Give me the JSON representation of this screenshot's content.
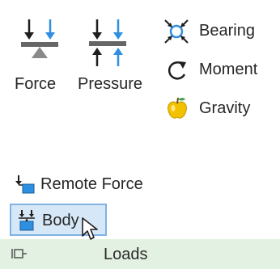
{
  "ribbon_panel": {
    "title": "Loads",
    "buttons": {
      "force": {
        "label": "Force",
        "icon": "force-icon"
      },
      "pressure": {
        "label": "Pressure",
        "icon": "pressure-icon"
      },
      "bearing": {
        "label": "Bearing",
        "icon": "bearing-icon"
      },
      "moment": {
        "label": "Moment",
        "icon": "moment-icon"
      },
      "gravity": {
        "label": "Gravity",
        "icon": "gravity-apple-icon"
      },
      "remote_force": {
        "label": "Remote Force",
        "icon": "remote-force-icon"
      },
      "body": {
        "label": "Body",
        "icon": "body-load-icon",
        "state": "hovered"
      }
    },
    "footer_icon": "panel-pin-icon"
  },
  "colors": {
    "accent_blue": "#2f8fe0",
    "hover_fill": "#d6e8f7",
    "hover_border": "#7fb2e5",
    "panel_footer": "#e3f1e2",
    "gravity_yellow": "#f2c200"
  }
}
